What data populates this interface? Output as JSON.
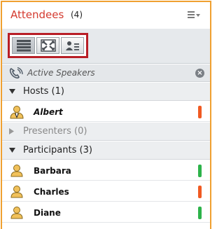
{
  "header": {
    "title": "Attendees",
    "count": "(4)",
    "menu_icon": "menu-lines-icon"
  },
  "toolbar": {
    "views": [
      {
        "name": "list-view",
        "icon": "list-view-icon",
        "active": true
      },
      {
        "name": "grid-view",
        "icon": "grid-view-icon",
        "active": false
      },
      {
        "name": "attendee-detail-view",
        "icon": "attendee-detail-icon",
        "active": false
      }
    ]
  },
  "active_speakers": {
    "label": "Active Speakers",
    "icon": "phone-speaker-icon",
    "close_icon": "close-circle-icon"
  },
  "sections": {
    "hosts": {
      "label": "Hosts (1)",
      "expanded": true
    },
    "presenters": {
      "label": "Presenters (0)",
      "expanded": false
    },
    "participants": {
      "label": "Participants (3)",
      "expanded": true
    }
  },
  "attendees": {
    "hosts": [
      {
        "name": "Albert",
        "status_color": "#f05a22",
        "icon": "host-user-icon"
      }
    ],
    "participants": [
      {
        "name": "Barbara",
        "status_color": "#2db34a",
        "icon": "user-icon"
      },
      {
        "name": "Charles",
        "status_color": "#f05a22",
        "icon": "user-icon"
      },
      {
        "name": "Diane",
        "status_color": "#2db34a",
        "icon": "user-icon"
      }
    ]
  },
  "colors": {
    "accent_border": "#f0a030",
    "title_red": "#d43a2f",
    "selection_outline": "#b81e26"
  }
}
